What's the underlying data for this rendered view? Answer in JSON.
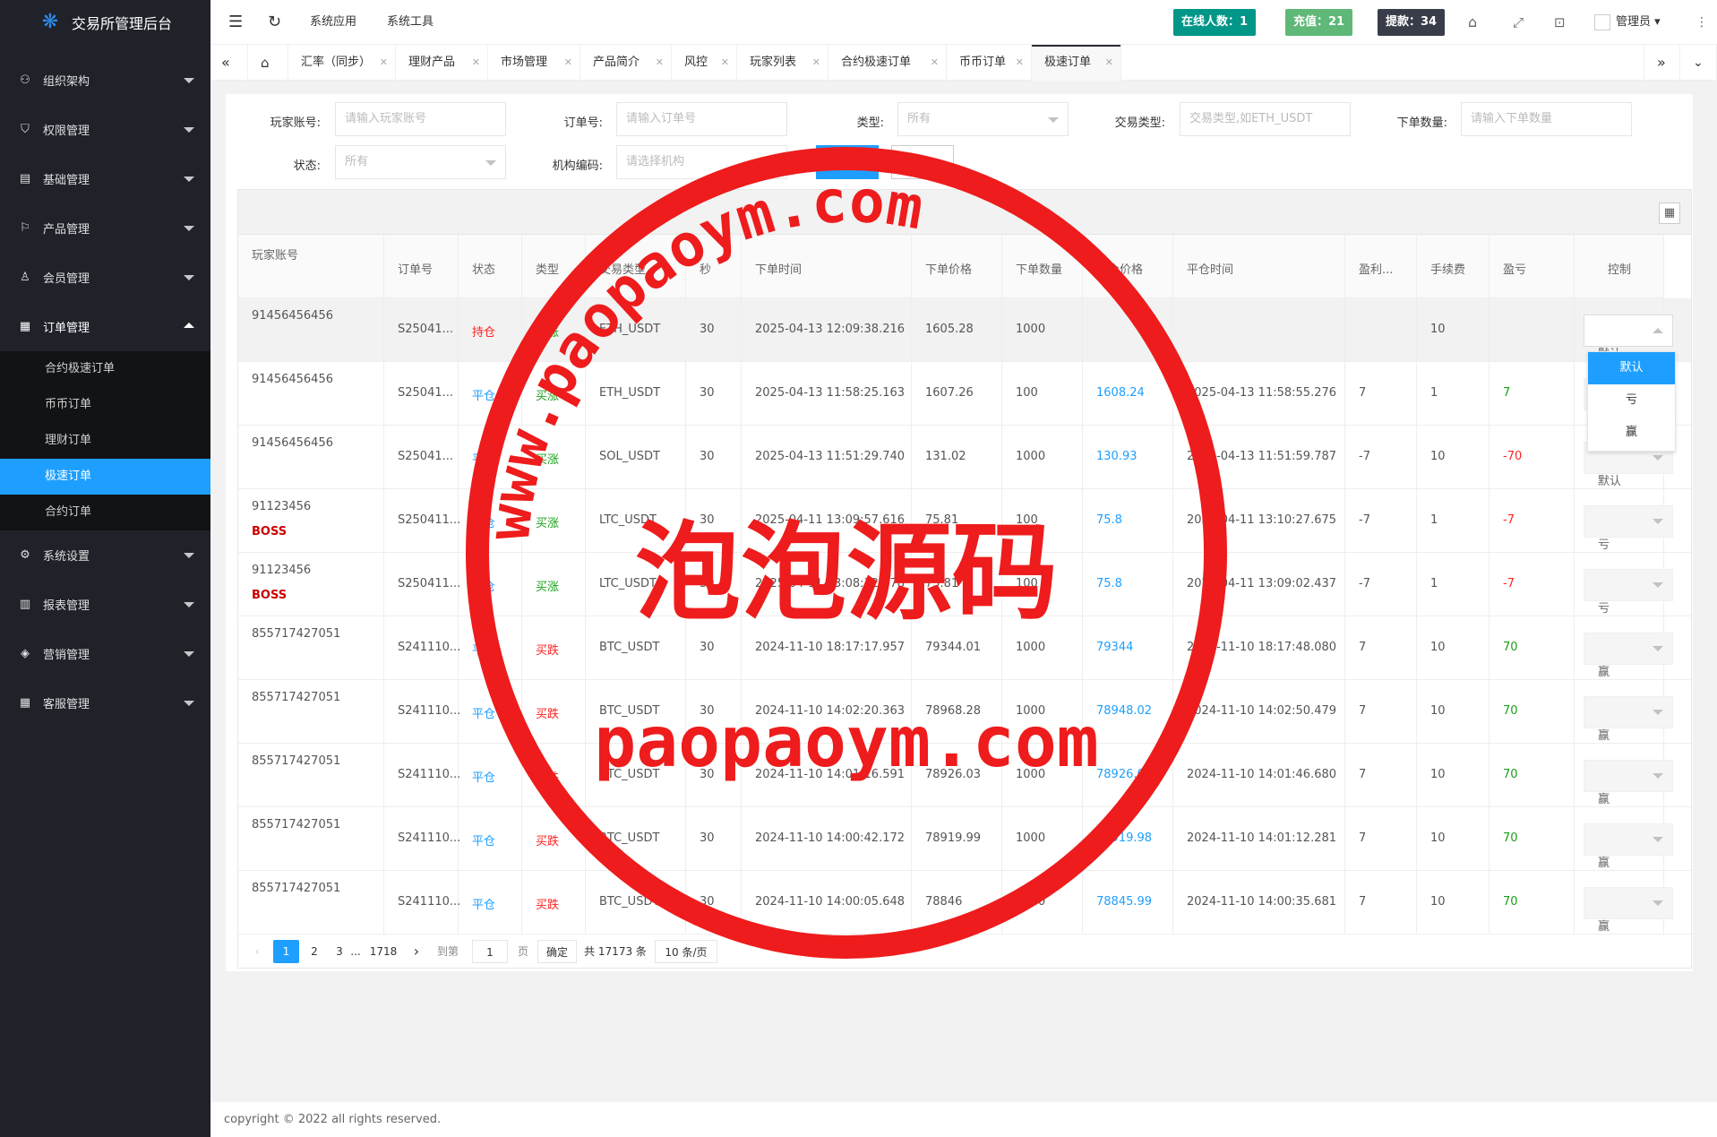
{
  "app": {
    "title": "交易所管理后台"
  },
  "colors": {
    "sidebar": "#20222a",
    "accent": "#1e9fff",
    "online": "#009688",
    "recharge": "#5fb878",
    "withdraw": "#393d49",
    "stamp": "#ee1c1c"
  },
  "sidebar": {
    "items": [
      {
        "label": "组织架构",
        "icon": "org-icon"
      },
      {
        "label": "权限管理",
        "icon": "shield-icon"
      },
      {
        "label": "基础管理",
        "icon": "base-icon"
      },
      {
        "label": "产品管理",
        "icon": "flag-icon"
      },
      {
        "label": "会员管理",
        "icon": "user-icon"
      },
      {
        "label": "订单管理",
        "icon": "grid-icon"
      },
      {
        "label": "系统设置",
        "icon": "gear-icon"
      },
      {
        "label": "报表管理",
        "icon": "report-icon"
      },
      {
        "label": "营销管理",
        "icon": "speaker-icon"
      },
      {
        "label": "客服管理",
        "icon": "service-icon"
      }
    ],
    "sub": [
      "合约极速订单",
      "币币订单",
      "理财订单",
      "极速订单",
      "合约订单"
    ]
  },
  "header": {
    "nav": [
      "系统应用",
      "系统工具"
    ],
    "online": "在线人数：1",
    "recharge": "充值：21",
    "withdraw": "提款：34",
    "user": "管理员"
  },
  "tabs": [
    "汇率（同步）",
    "理财产品",
    "市场管理",
    "产品简介",
    "风控",
    "玩家列表",
    "合约极速订单",
    "币币订单",
    "极速订单"
  ],
  "filters": {
    "player_label": "玩家账号:",
    "player_ph": "请输入玩家账号",
    "order_label": "订单号:",
    "order_ph": "请输入订单号",
    "type_label": "类型:",
    "type_val": "所有",
    "trade_label": "交易类型:",
    "trade_ph": "交易类型,如ETH_USDT",
    "qty_label": "下单数量:",
    "qty_ph": "请输入下单数量",
    "status_label": "状态:",
    "status_val": "所有",
    "org_label": "机构编码:",
    "org_ph": "请选择机构"
  },
  "table": {
    "columns": [
      "玩家账号",
      "订单号",
      "状态",
      "类型",
      "交易类型",
      "秒",
      "下单时间",
      "下单价格",
      "下单数量",
      "平仓价格",
      "平仓时间",
      "盈利...",
      "手续费",
      "盈亏",
      "控制"
    ],
    "rows": [
      {
        "acc": "91456456456",
        "boss": "",
        "order": "S25041...",
        "status": "持仓",
        "type": "买涨",
        "pair": "ETH_USDT",
        "sec": "30",
        "time": "2025-04-13 12:09:38.216",
        "price": "1605.28",
        "qty": "1000",
        "close": "",
        "ctime": "",
        "rate": "",
        "fee": "10",
        "pnl": "",
        "ctl": "默认"
      },
      {
        "acc": "91456456456",
        "boss": "",
        "order": "S25041...",
        "status": "平仓",
        "type": "买涨",
        "pair": "ETH_USDT",
        "sec": "30",
        "time": "2025-04-13 11:58:25.163",
        "price": "1607.26",
        "qty": "100",
        "close": "1608.24",
        "ctime": "2025-04-13 11:58:55.276",
        "rate": "7",
        "fee": "1",
        "pnl": "7",
        "ctl": "默认"
      },
      {
        "acc": "91456456456",
        "boss": "",
        "order": "S25041...",
        "status": "平仓",
        "type": "买涨",
        "pair": "SOL_USDT",
        "sec": "30",
        "time": "2025-04-13 11:51:29.740",
        "price": "131.02",
        "qty": "1000",
        "close": "130.93",
        "ctime": "2025-04-13 11:51:59.787",
        "rate": "-7",
        "fee": "10",
        "pnl": "-70",
        "ctl": "默认"
      },
      {
        "acc": "91123456",
        "boss": "BOSS",
        "order": "S250411...",
        "status": "平仓",
        "type": "买涨",
        "pair": "LTC_USDT",
        "sec": "30",
        "time": "2025-04-11 13:09:57.616",
        "price": "75.81",
        "qty": "100",
        "close": "75.8",
        "ctime": "2025-04-11 13:10:27.675",
        "rate": "-7",
        "fee": "1",
        "pnl": "-7",
        "ctl": "亏"
      },
      {
        "acc": "91123456",
        "boss": "BOSS",
        "order": "S250411...",
        "status": "平仓",
        "type": "买涨",
        "pair": "LTC_USDT",
        "sec": "30",
        "time": "2025-04-11 13:08:32.378",
        "price": "75.81",
        "qty": "100",
        "close": "75.8",
        "ctime": "2025-04-11 13:09:02.437",
        "rate": "-7",
        "fee": "1",
        "pnl": "-7",
        "ctl": "亏"
      },
      {
        "acc": "855717427051",
        "boss": "",
        "order": "S241110...",
        "status": "平仓",
        "type": "买跌",
        "pair": "BTC_USDT",
        "sec": "30",
        "time": "2024-11-10 18:17:17.957",
        "price": "79344.01",
        "qty": "1000",
        "close": "79344",
        "ctime": "2024-11-10 18:17:48.080",
        "rate": "7",
        "fee": "10",
        "pnl": "70",
        "ctl": "赢"
      },
      {
        "acc": "855717427051",
        "boss": "",
        "order": "S241110...",
        "status": "平仓",
        "type": "买跌",
        "pair": "BTC_USDT",
        "sec": "30",
        "time": "2024-11-10 14:02:20.363",
        "price": "78968.28",
        "qty": "1000",
        "close": "78948.02",
        "ctime": "2024-11-10 14:02:50.479",
        "rate": "7",
        "fee": "10",
        "pnl": "70",
        "ctl": "赢"
      },
      {
        "acc": "855717427051",
        "boss": "",
        "order": "S241110...",
        "status": "平仓",
        "type": "买跌",
        "pair": "BTC_USDT",
        "sec": "30",
        "time": "2024-11-10 14:01:16.591",
        "price": "78926.03",
        "qty": "1000",
        "close": "78926.02",
        "ctime": "2024-11-10 14:01:46.680",
        "rate": "7",
        "fee": "10",
        "pnl": "70",
        "ctl": "赢"
      },
      {
        "acc": "855717427051",
        "boss": "",
        "order": "S241110...",
        "status": "平仓",
        "type": "买跌",
        "pair": "BTC_USDT",
        "sec": "30",
        "time": "2024-11-10 14:00:42.172",
        "price": "78919.99",
        "qty": "1000",
        "close": "78919.98",
        "ctime": "2024-11-10 14:01:12.281",
        "rate": "7",
        "fee": "10",
        "pnl": "70",
        "ctl": "赢"
      },
      {
        "acc": "855717427051",
        "boss": "",
        "order": "S241110...",
        "status": "平仓",
        "type": "买跌",
        "pair": "BTC_USDT",
        "sec": "30",
        "time": "2024-11-10 14:00:05.648",
        "price": "78846",
        "qty": "1000",
        "close": "78845.99",
        "ctime": "2024-11-10 14:00:35.681",
        "rate": "7",
        "fee": "10",
        "pnl": "70",
        "ctl": "赢"
      }
    ]
  },
  "dropdown": {
    "options": [
      "默认",
      "亏",
      "赢"
    ]
  },
  "pager": {
    "pages": [
      "1",
      "2",
      "3",
      "...",
      "1718"
    ],
    "goto": "到第",
    "page_input": "1",
    "page_unit": "页",
    "confirm": "确定",
    "total": "共 17173 条",
    "per_page": "10 条/页"
  },
  "footer": {
    "copyright": "copyright © 2022 all rights reserved."
  },
  "watermark": {
    "url_top": "www.paopaoym.com",
    "cn": "泡泡源码",
    "url_bottom": "paopaoym.com"
  }
}
